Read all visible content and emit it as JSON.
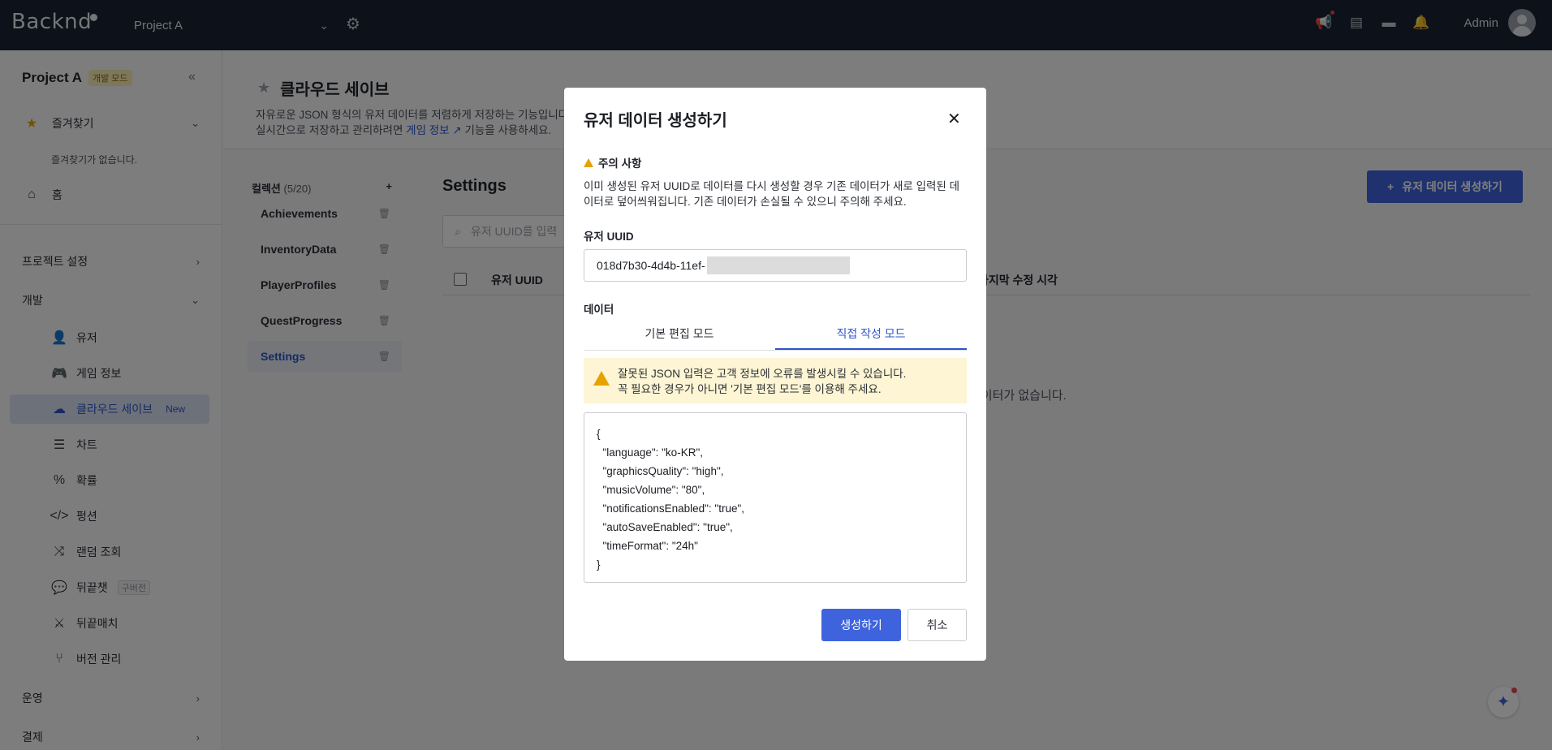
{
  "topbar": {
    "logo": "Backnd",
    "project": "Project A",
    "admin": "Admin",
    "icons": [
      "megaphone-icon",
      "docs-icon",
      "chat-icon",
      "bell-icon",
      "gear-icon"
    ]
  },
  "sidebar": {
    "project": "Project A",
    "dev_badge": "개발 모드",
    "favorites": "즐겨찾기",
    "favorites_empty": "즐겨찾기가 없습니다.",
    "home": "홈",
    "project_settings": "프로젝트 설정",
    "dev": "개발",
    "items": [
      {
        "label": "유저",
        "icon": "user-icon"
      },
      {
        "label": "게임 정보",
        "icon": "gamepad-icon"
      },
      {
        "label": "클라우드 세이브",
        "icon": "cloud-icon",
        "tag": "New"
      },
      {
        "label": "차트",
        "icon": "table-icon"
      },
      {
        "label": "확률",
        "icon": "percent-icon"
      },
      {
        "label": "펑션",
        "icon": "code-icon"
      },
      {
        "label": "랜덤 조회",
        "icon": "shuffle-icon"
      },
      {
        "label": "뒤끝챗",
        "icon": "chat-icon",
        "tag": "구버전"
      },
      {
        "label": "뒤끝매치",
        "icon": "match-icon"
      },
      {
        "label": "버전 관리",
        "icon": "branch-icon"
      }
    ],
    "operation": "운영",
    "payment": "결제"
  },
  "page": {
    "title": "클라우드 세이브",
    "desc_1": "자유로운 JSON 형식의 유저 데이터를 저렴하게 저장하는 기능입니다.",
    "desc_2": "실시간으로 저장하고 관리하려면",
    "desc_link": "게임 정보",
    "desc_3": "기능을 사용하세요.",
    "collections_label": "컬렉션",
    "collections_count": "(5/20)",
    "collections": [
      "Achievements",
      "InventoryData",
      "PlayerProfiles",
      "QuestProgress",
      "Settings"
    ],
    "settings_title": "Settings",
    "search_placeholder": "유저 UUID를 입력",
    "col_uuid": "유저 UUID",
    "col_modified": "마지막 수정 시각",
    "empty": "데이터가 없습니다.",
    "create_button": "유저 데이터 생성하기"
  },
  "modal": {
    "title": "유저 데이터 생성하기",
    "warn_title": "주의 사항",
    "warn_text": "이미 생성된 유저 UUID로 데이터를 다시 생성할 경우 기존 데이터가 새로 입력된 데이터로 덮어씌워집니다. 기존 데이터가 손실될 수 있으니 주의해 주세요.",
    "uuid_label": "유저 UUID",
    "uuid_value": "018d7b30-4d4b-11ef-",
    "data_label": "데이터",
    "tab_basic": "기본 편집 모드",
    "tab_direct": "직접 작성 모드",
    "alert_1": "잘못된 JSON 입력은 고객 정보에 오류를 발생시킬 수 있습니다.",
    "alert_2": "꼭 필요한 경우가 아니면 '기본 편집 모드'를 이용해 주세요.",
    "json_text": "{\n  \"language\": \"ko-KR\",\n  \"graphicsQuality\": \"high\",\n  \"musicVolume\": \"80\",\n  \"notificationsEnabled\": \"true\",\n  \"autoSaveEnabled\": \"true\",\n  \"timeFormat\": \"24h\"\n}",
    "submit": "생성하기",
    "cancel": "취소"
  },
  "colors": {
    "accent": "#3e63dd",
    "topbar": "#1b2333",
    "warning": "#e8a200"
  }
}
